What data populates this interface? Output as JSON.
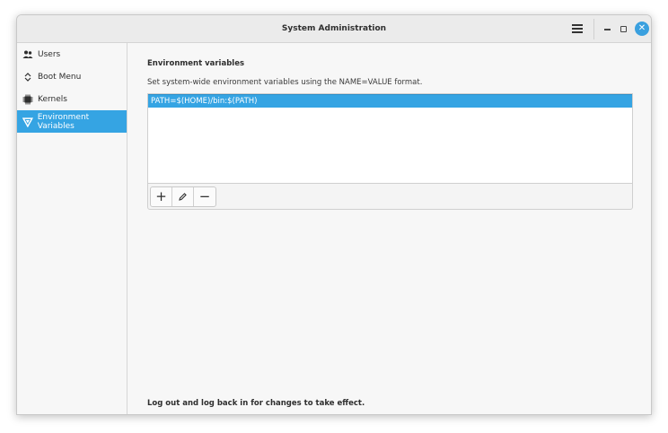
{
  "window": {
    "title": "System Administration"
  },
  "sidebar": {
    "items": [
      {
        "label": "Users",
        "icon": "users-icon",
        "active": false
      },
      {
        "label": "Boot Menu",
        "icon": "updown-icon",
        "active": false
      },
      {
        "label": "Kernels",
        "icon": "chip-icon",
        "active": false
      },
      {
        "label": "Environment Variables",
        "icon": "triangle-icon",
        "active": true
      }
    ]
  },
  "main": {
    "heading": "Environment variables",
    "description": "Set system-wide environment variables using the NAME=VALUE format.",
    "variables": [
      "PATH=$(HOME)/bin:$(PATH)"
    ],
    "toolbar": {
      "add_icon": "+",
      "edit_icon": "pencil-icon",
      "remove_icon": "−"
    },
    "footer": "Log out and log back in for changes to take effect."
  },
  "colors": {
    "accent": "#35a4e3",
    "close": "#3aa0df"
  }
}
